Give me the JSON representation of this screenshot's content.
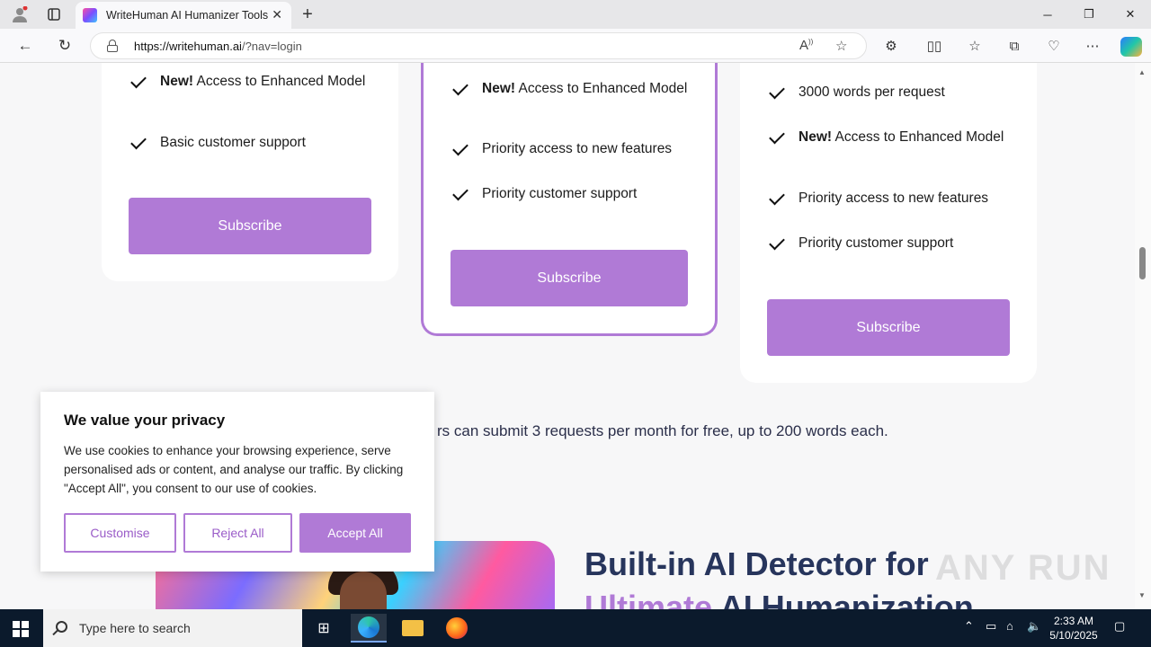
{
  "browser": {
    "tab_title": "WriteHuman AI Humanizer Tools",
    "url_host": "https://writehuman.ai",
    "url_path": "/?nav=login"
  },
  "plans": [
    {
      "features": [
        {
          "bold": "New!",
          "text": " Access to Enhanced Model"
        },
        {
          "bold": "",
          "text": "Basic customer support"
        }
      ],
      "button": "Subscribe"
    },
    {
      "features": [
        {
          "bold": "New!",
          "text": " Access to Enhanced Model"
        },
        {
          "bold": "",
          "text": "Priority access to new features"
        },
        {
          "bold": "",
          "text": "Priority customer support"
        }
      ],
      "button": "Subscribe"
    },
    {
      "features": [
        {
          "bold": "",
          "text": "3000 words per request"
        },
        {
          "bold": "New!",
          "text": " Access to Enhanced Model"
        },
        {
          "bold": "",
          "text": "Priority access to new features"
        },
        {
          "bold": "",
          "text": "Priority customer support"
        }
      ],
      "button": "Subscribe"
    }
  ],
  "free_note": "rs can submit 3 requests per month for free, up to 200 words each.",
  "hero": {
    "title_line1": "Built-in AI Detector for",
    "title_line2_accent": "Ultimate",
    "title_line2_rest": " AI Humanization"
  },
  "cookie": {
    "title": "We value your privacy",
    "text": "We use cookies to enhance your browsing experience, serve personalised ads or content, and analyse our traffic. By clicking \"Accept All\", you consent to our use of cookies.",
    "customise": "Customise",
    "reject": "Reject All",
    "accept": "Accept All"
  },
  "watermark": "ANY RUN",
  "taskbar": {
    "search_placeholder": "Type here to search",
    "time": "2:33 AM",
    "date": "5/10/2025"
  },
  "colors": {
    "accent": "#b07ad6",
    "heading": "#27355c",
    "taskbar": "#0b1a2c"
  }
}
